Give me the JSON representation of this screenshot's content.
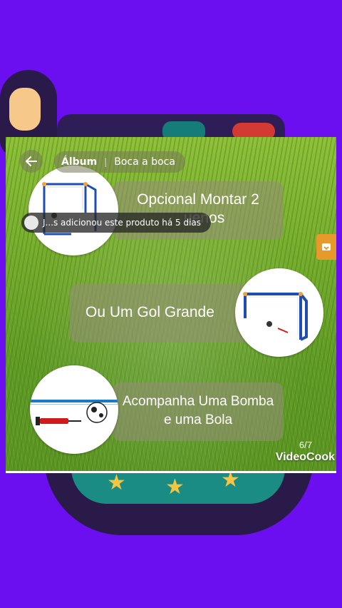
{
  "header": {
    "back_icon": "back-arrow-icon",
    "tabs": [
      {
        "label": "Álbum",
        "active": true
      },
      {
        "label": "Boca a boca",
        "active": false
      }
    ]
  },
  "toast": {
    "text": "J...s adicionou este produto há 5 dias"
  },
  "slides": [
    {
      "line1": "Opcional Montar 2",
      "line2": "Gols Pequenos",
      "visible_line2": "uenos",
      "image": "small-goal-image"
    },
    {
      "line1": "Ou Um Gol Grande",
      "image": "large-goal-image"
    },
    {
      "line1": "Acompanha Uma Bomba",
      "line2": "e uma Bola",
      "image": "pump-and-ball-image"
    }
  ],
  "pagination": {
    "current": 6,
    "total": 7,
    "label": "6/7"
  },
  "watermark": "VideoCook",
  "colors": {
    "background": "#6b0ff0",
    "grass": "#76ad2e",
    "goal_frame": "#1e4fb0",
    "goal_corner": "#f2a23a",
    "pump_red": "#d11a1a"
  }
}
